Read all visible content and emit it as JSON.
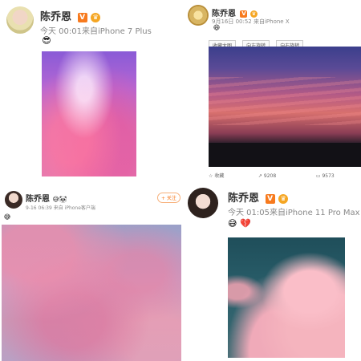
{
  "posts": [
    {
      "username": "陈乔恩",
      "verified_badge": "V",
      "timestamp": "今天 00:01来自iPhone 7 Plus",
      "reaction_emoji": "😎"
    },
    {
      "username": "陈乔恩",
      "verified_badge": "V",
      "timestamp": "9月16日 00:52 来自iPhone X",
      "reaction_emoji": "😄",
      "buttons": [
        "收藏大图",
        "向左旋转",
        "向右旋转"
      ],
      "actions": [
        {
          "label": "收藏",
          "icon": "star-icon"
        },
        {
          "label": "9208",
          "icon": "share-icon"
        },
        {
          "label": "9573",
          "icon": "comment-icon"
        }
      ]
    },
    {
      "username": "陈乔恩",
      "badges": "😅🐼",
      "timestamp": "9-16 06:39",
      "source": "来自 iPhone客户端",
      "follow_button": "+ 关注",
      "reaction_emoji": "😅"
    },
    {
      "username": "陈乔恩",
      "verified_badge": "V",
      "timestamp": "今天 01:05来自iPhone 11 Pro Max",
      "reaction_emojis": [
        "😅",
        "💔"
      ]
    }
  ]
}
